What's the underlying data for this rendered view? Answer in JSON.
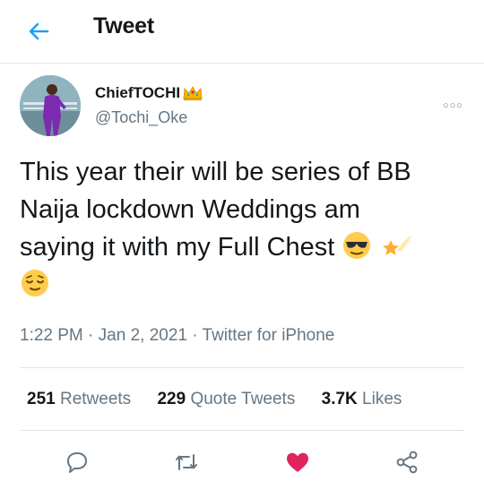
{
  "header": {
    "title": "Tweet"
  },
  "author": {
    "name": "ChiefTOCHI",
    "handle": "@Tochi_Oke"
  },
  "tweet": {
    "line1": "This year their will be series of BB",
    "line2": "Naija lockdown Weddings am",
    "line3": "saying it with my Full Chest",
    "time": "1:22 PM",
    "date": "Jan 2, 2021",
    "source": "Twitter for iPhone",
    "separator": "·"
  },
  "stats": {
    "retweets_count": "251",
    "retweets_label": "Retweets",
    "quotes_count": "229",
    "quotes_label": "Quote Tweets",
    "likes_count": "3.7K",
    "likes_label": "Likes"
  },
  "colors": {
    "accent": "#1da1f2",
    "like": "#e0245e",
    "muted": "#657786"
  },
  "icons": [
    "back-arrow-icon",
    "crown-icon",
    "more-options-icon",
    "sunglasses-emoji-icon",
    "dizzy-star-emoji-icon",
    "relieved-face-emoji-icon",
    "reply-icon",
    "retweet-icon",
    "like-icon",
    "share-icon"
  ]
}
